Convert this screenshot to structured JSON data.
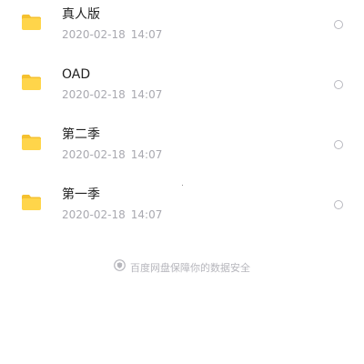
{
  "files": [
    {
      "name": "真人版",
      "date": "2020-02-18",
      "time": "14:07",
      "icon": "folder-icon"
    },
    {
      "name": "OAD",
      "date": "2020-02-18",
      "time": "14:07",
      "icon": "folder-icon"
    },
    {
      "name": "第二季",
      "date": "2020-02-18",
      "time": "14:07",
      "icon": "folder-icon"
    },
    {
      "name": "第一季",
      "date": "2020-02-18",
      "time": "14:07",
      "icon": "folder-icon"
    }
  ],
  "footer": {
    "text": "百度网盘保障你的数据安全",
    "icon": "shield-icon"
  },
  "colors": {
    "folder": "#FFD54A",
    "folder_tab": "#F5C130",
    "name_text": "#222222",
    "meta_text": "#A9A9B0",
    "radio_border": "#B8B8BF"
  }
}
